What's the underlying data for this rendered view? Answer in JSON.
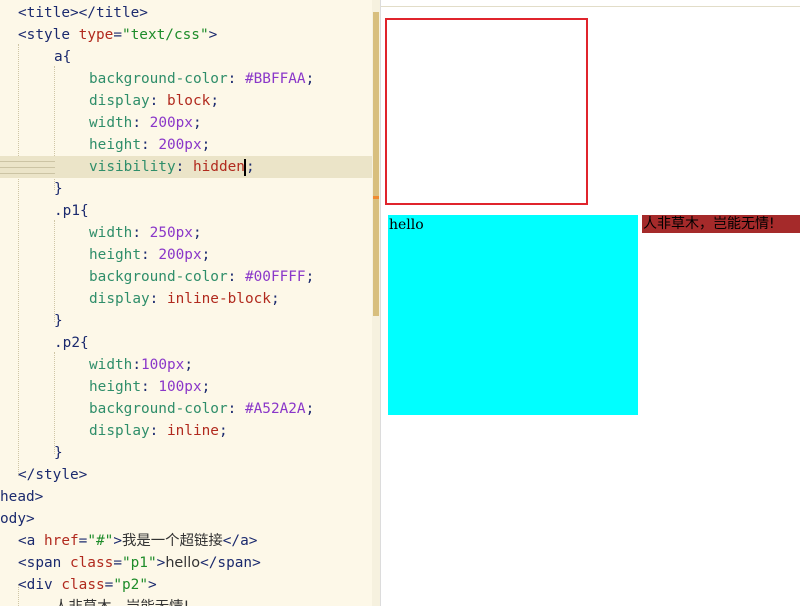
{
  "editor": {
    "lines": [
      {
        "id": "l1",
        "parts": [
          {
            "c": "t-tag",
            "t": "<title></title>"
          }
        ]
      },
      {
        "id": "l2",
        "parts": [
          {
            "c": "t-tag",
            "t": "<style "
          },
          {
            "c": "t-attr",
            "t": "type"
          },
          {
            "c": "t-tag",
            "t": "="
          },
          {
            "c": "t-str",
            "t": "\"text/css\""
          },
          {
            "c": "t-tag",
            "t": ">"
          }
        ]
      },
      {
        "id": "l3",
        "parts": [
          {
            "c": "t-sel",
            "t": "a{"
          }
        ]
      },
      {
        "id": "l4",
        "parts": [
          {
            "c": "t-prop",
            "t": "background-color"
          },
          {
            "c": "t-tag",
            "t": ": "
          },
          {
            "c": "t-num",
            "t": "#BBFFAA"
          },
          {
            "c": "t-tag",
            "t": ";"
          }
        ]
      },
      {
        "id": "l5",
        "parts": [
          {
            "c": "t-prop",
            "t": "display"
          },
          {
            "c": "t-tag",
            "t": ": "
          },
          {
            "c": "t-kw",
            "t": "block"
          },
          {
            "c": "t-tag",
            "t": ";"
          }
        ]
      },
      {
        "id": "l6",
        "parts": [
          {
            "c": "t-prop",
            "t": "width"
          },
          {
            "c": "t-tag",
            "t": ": "
          },
          {
            "c": "t-num",
            "t": "200px"
          },
          {
            "c": "t-tag",
            "t": ";"
          }
        ]
      },
      {
        "id": "l7",
        "parts": [
          {
            "c": "t-prop",
            "t": "height"
          },
          {
            "c": "t-tag",
            "t": ": "
          },
          {
            "c": "t-num",
            "t": "200px"
          },
          {
            "c": "t-tag",
            "t": ";"
          }
        ]
      },
      {
        "id": "l8",
        "parts": [
          {
            "c": "t-prop",
            "t": "visibility"
          },
          {
            "c": "t-tag",
            "t": ": "
          },
          {
            "c": "t-kw",
            "t": "hidden"
          },
          {
            "c": "caret",
            "t": ""
          },
          {
            "c": "t-tag",
            "t": ";"
          }
        ]
      },
      {
        "id": "l9",
        "parts": [
          {
            "c": "t-sel",
            "t": "}"
          }
        ]
      },
      {
        "id": "l10",
        "parts": [
          {
            "c": "t-sel",
            "t": ".p1{"
          }
        ]
      },
      {
        "id": "l11",
        "parts": [
          {
            "c": "t-prop",
            "t": "width"
          },
          {
            "c": "t-tag",
            "t": ": "
          },
          {
            "c": "t-num",
            "t": "250px"
          },
          {
            "c": "t-tag",
            "t": ";"
          }
        ]
      },
      {
        "id": "l12",
        "parts": [
          {
            "c": "t-prop",
            "t": "height"
          },
          {
            "c": "t-tag",
            "t": ": "
          },
          {
            "c": "t-num",
            "t": "200px"
          },
          {
            "c": "t-tag",
            "t": ";"
          }
        ]
      },
      {
        "id": "l13",
        "parts": [
          {
            "c": "t-prop",
            "t": "background-color"
          },
          {
            "c": "t-tag",
            "t": ": "
          },
          {
            "c": "t-num",
            "t": "#00FFFF"
          },
          {
            "c": "t-tag",
            "t": ";"
          }
        ]
      },
      {
        "id": "l14",
        "parts": [
          {
            "c": "t-prop",
            "t": "display"
          },
          {
            "c": "t-tag",
            "t": ": "
          },
          {
            "c": "t-kw",
            "t": "inline-block"
          },
          {
            "c": "t-tag",
            "t": ";"
          }
        ]
      },
      {
        "id": "l15",
        "parts": [
          {
            "c": "t-sel",
            "t": "}"
          }
        ]
      },
      {
        "id": "l16",
        "parts": [
          {
            "c": "t-sel",
            "t": ".p2{"
          }
        ]
      },
      {
        "id": "l17",
        "parts": [
          {
            "c": "t-prop",
            "t": "width"
          },
          {
            "c": "t-tag",
            "t": ":"
          },
          {
            "c": "t-num",
            "t": "100px"
          },
          {
            "c": "t-tag",
            "t": ";"
          }
        ]
      },
      {
        "id": "l18",
        "parts": [
          {
            "c": "t-prop",
            "t": "height"
          },
          {
            "c": "t-tag",
            "t": ": "
          },
          {
            "c": "t-num",
            "t": "100px"
          },
          {
            "c": "t-tag",
            "t": ";"
          }
        ]
      },
      {
        "id": "l19",
        "parts": [
          {
            "c": "t-prop",
            "t": "background-color"
          },
          {
            "c": "t-tag",
            "t": ": "
          },
          {
            "c": "t-num",
            "t": "#A52A2A"
          },
          {
            "c": "t-tag",
            "t": ";"
          }
        ]
      },
      {
        "id": "l20",
        "parts": [
          {
            "c": "t-prop",
            "t": "display"
          },
          {
            "c": "t-tag",
            "t": ": "
          },
          {
            "c": "t-kw",
            "t": "inline"
          },
          {
            "c": "t-tag",
            "t": ";"
          }
        ]
      },
      {
        "id": "l21",
        "parts": [
          {
            "c": "t-sel",
            "t": "}"
          }
        ]
      },
      {
        "id": "l22",
        "parts": [
          {
            "c": "t-tag",
            "t": "</style>"
          }
        ]
      },
      {
        "id": "l23",
        "parts": [
          {
            "c": "t-tag",
            "t": "head>"
          }
        ]
      },
      {
        "id": "l24",
        "parts": [
          {
            "c": "t-tag",
            "t": "ody>"
          }
        ]
      },
      {
        "id": "l25",
        "parts": [
          {
            "c": "t-tag",
            "t": "<a "
          },
          {
            "c": "t-attr",
            "t": "href"
          },
          {
            "c": "t-tag",
            "t": "="
          },
          {
            "c": "t-str",
            "t": "\"#\""
          },
          {
            "c": "t-tag",
            "t": ">"
          },
          {
            "c": "t-txt",
            "t": "我是一个超链接"
          },
          {
            "c": "t-tag",
            "t": "</a>"
          }
        ]
      },
      {
        "id": "l26",
        "parts": [
          {
            "c": "t-tag",
            "t": "<span "
          },
          {
            "c": "t-attr",
            "t": "class"
          },
          {
            "c": "t-tag",
            "t": "="
          },
          {
            "c": "t-str",
            "t": "\"p1\""
          },
          {
            "c": "t-tag",
            "t": ">"
          },
          {
            "c": "t-txt",
            "t": "hello"
          },
          {
            "c": "t-tag",
            "t": "</span>"
          }
        ]
      },
      {
        "id": "l27",
        "parts": [
          {
            "c": "t-tag",
            "t": "<div "
          },
          {
            "c": "t-attr",
            "t": "class"
          },
          {
            "c": "t-tag",
            "t": "="
          },
          {
            "c": "t-str",
            "t": "\"p2\""
          },
          {
            "c": "t-tag",
            "t": ">"
          }
        ]
      },
      {
        "id": "l28",
        "parts": [
          {
            "c": "t-txt",
            "t": "人非草木，岂能无情!"
          }
        ]
      }
    ]
  },
  "preview": {
    "span_text": "hello",
    "div_text": "人非草木，岂能无情!",
    "colors": {
      "p1_background": "#00FFFF",
      "p2_background": "#A52A2A",
      "hidden_link_outline": "#E0242C"
    }
  }
}
